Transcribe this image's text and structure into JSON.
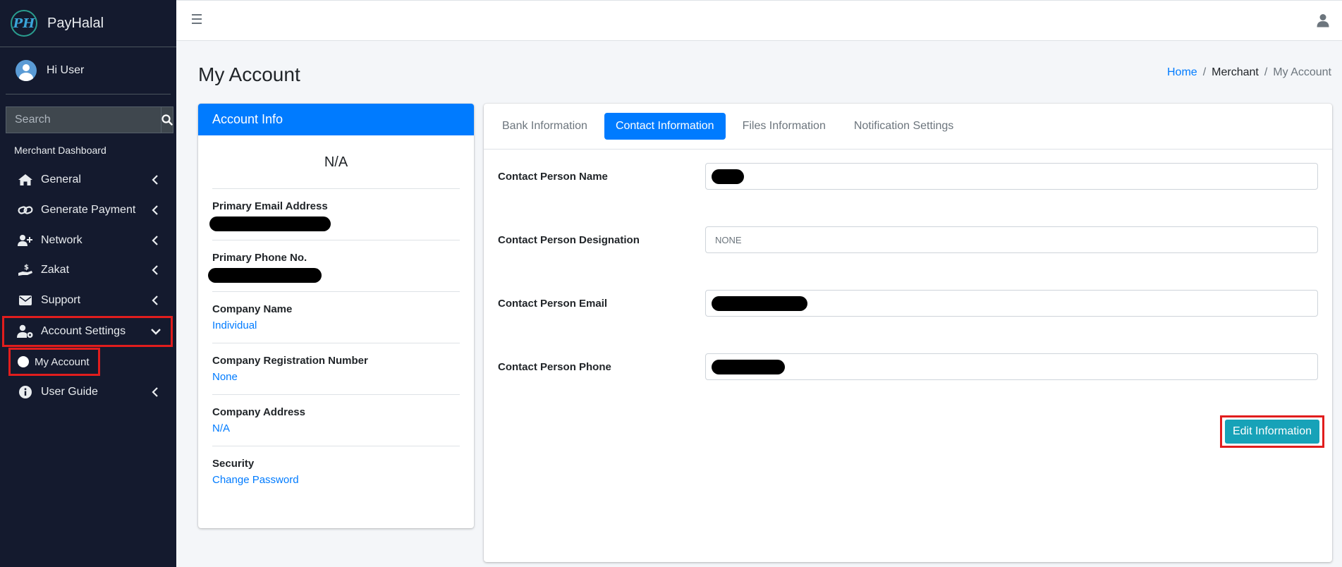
{
  "brand": {
    "logo_text": "PH",
    "name": "PayHalal"
  },
  "user_panel": {
    "greeting": "Hi User"
  },
  "search": {
    "placeholder": "Search"
  },
  "sidebar": {
    "header": "Merchant Dashboard",
    "items": [
      {
        "label": "General",
        "icon": "home-icon"
      },
      {
        "label": "Generate Payment",
        "icon": "link-icon"
      },
      {
        "label": "Network",
        "icon": "user-plus-icon"
      },
      {
        "label": "Zakat",
        "icon": "hand-coin-icon"
      },
      {
        "label": "Support",
        "icon": "envelope-icon"
      },
      {
        "label": "Account Settings",
        "icon": "user-cog-icon",
        "expanded": true
      },
      {
        "label": "User Guide",
        "icon": "info-icon"
      }
    ],
    "sub_items": [
      {
        "label": "My Account",
        "icon": "circle-icon"
      }
    ]
  },
  "page": {
    "title": "My Account",
    "breadcrumb": {
      "home": "Home",
      "sep": "/",
      "merchant": "Merchant",
      "current": "My Account"
    }
  },
  "account_info": {
    "header": "Account Info",
    "name": "N/A",
    "rows": [
      {
        "label": "Primary Email Address",
        "value": null,
        "redacted": true
      },
      {
        "label": "Primary Phone No.",
        "value": null,
        "redacted": true
      },
      {
        "label": "Company Name",
        "value": "Individual"
      },
      {
        "label": "Company Registration Number",
        "value": "None"
      },
      {
        "label": "Company Address",
        "value": "N/A"
      },
      {
        "label": "Security",
        "value": "Change Password"
      }
    ]
  },
  "tabs": [
    {
      "label": "Bank Information",
      "active": false
    },
    {
      "label": "Contact Information",
      "active": true
    },
    {
      "label": "Files Information",
      "active": false
    },
    {
      "label": "Notification Settings",
      "active": false
    }
  ],
  "contact_form": {
    "fields": [
      {
        "label": "Contact Person Name",
        "value": null,
        "redacted": true
      },
      {
        "label": "Contact Person Designation",
        "value": "NONE"
      },
      {
        "label": "Contact Person Email",
        "value": null,
        "redacted": true
      },
      {
        "label": "Contact Person Phone",
        "value": null,
        "redacted": true
      }
    ],
    "edit_button": "Edit Information"
  },
  "colors": {
    "sidebar_bg": "#141a2e",
    "primary": "#007bff",
    "info": "#17a2b8",
    "highlight": "#e11d1d"
  }
}
